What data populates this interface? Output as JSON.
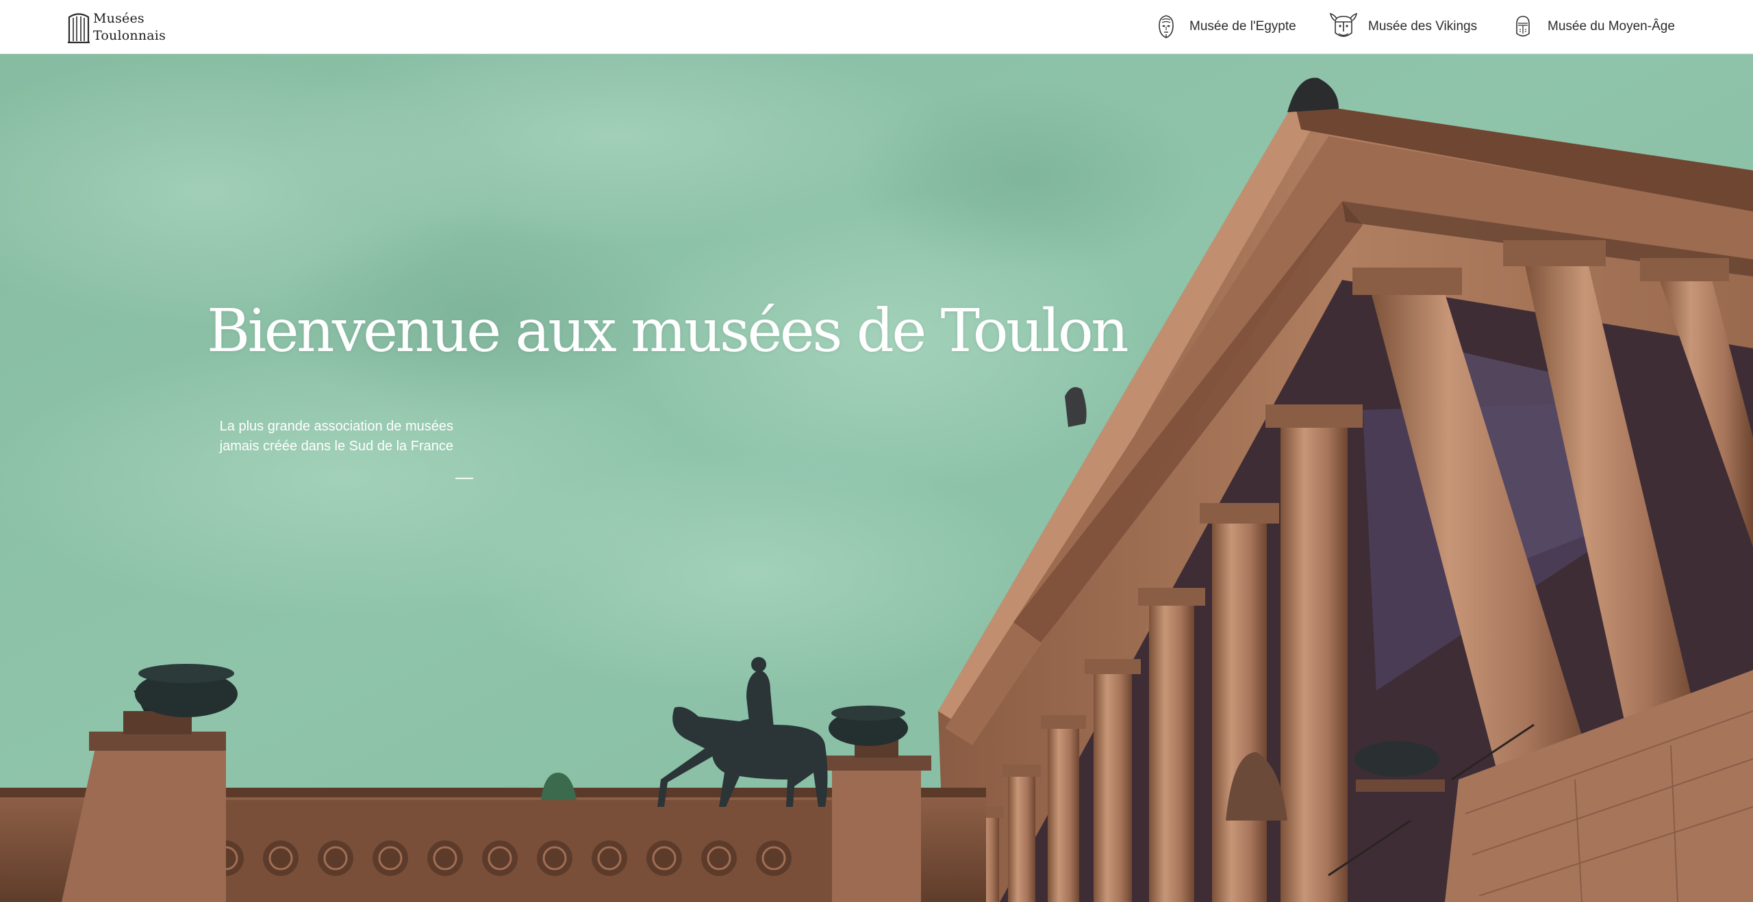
{
  "brand": {
    "line1": "Musées",
    "line2": "Toulonnais",
    "icon": "columns-logo-icon"
  },
  "nav": {
    "items": [
      {
        "label": "Musée de l'Egypte",
        "icon": "egyptian-mask-icon"
      },
      {
        "label": "Musée des Vikings",
        "icon": "viking-helmet-icon"
      },
      {
        "label": "Musée du Moyen-Âge",
        "icon": "knight-helmet-icon"
      }
    ]
  },
  "hero": {
    "title": "Bienvenue aux musées de Toulon",
    "subtitle_line1": "La plus grande association de musées",
    "subtitle_line2": "jamais créée dans le Sud de la France"
  },
  "colors": {
    "sky": "#8fc3aa",
    "stone": "#a9765a",
    "text_dark": "#2b2b2b",
    "text_light": "#ffffff"
  }
}
